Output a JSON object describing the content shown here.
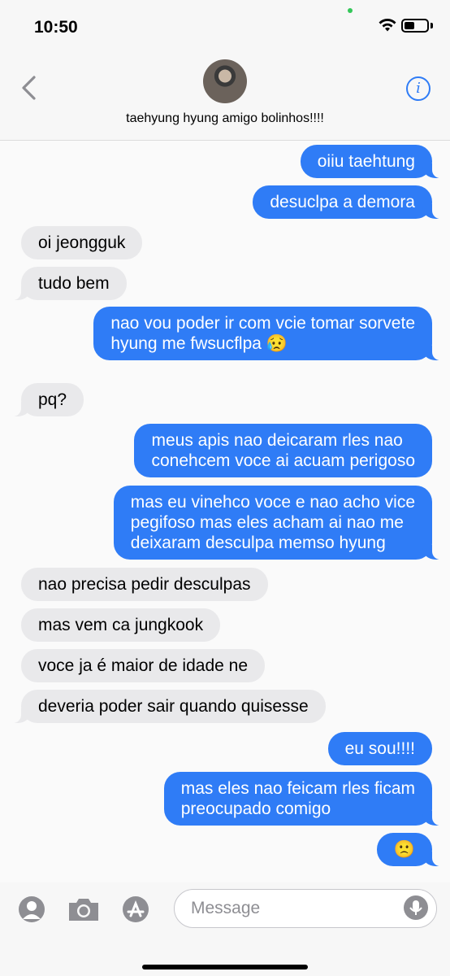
{
  "status_bar": {
    "time": "10:50",
    "battery_level": 0.45
  },
  "header": {
    "contact_name": "taehyung hyung amigo bolinhos!!!!"
  },
  "messages": [
    {
      "dir": "out",
      "text": "oiiu taehtung"
    },
    {
      "dir": "out",
      "text": "desuclpa a demora"
    },
    {
      "dir": "in",
      "text": "oi jeongguk"
    },
    {
      "dir": "in",
      "text": "tudo bem"
    },
    {
      "dir": "out",
      "text": "nao vou poder ir com vcie tomar sorvete\nhyung me fwsucflpa 😥"
    },
    {
      "dir": "in",
      "text": "pq?"
    },
    {
      "dir": "out",
      "text": "meus apis nao deicaram rles nao\nconehcem voce ai acuam perigoso"
    },
    {
      "dir": "out",
      "text": "mas eu vinehco voce e nao acho vice\npegifoso mas eles acham ai nao me\ndeixaram desculpa memso hyung"
    },
    {
      "dir": "in",
      "text": "nao precisa pedir desculpas"
    },
    {
      "dir": "in",
      "text": "mas vem ca jungkook"
    },
    {
      "dir": "in",
      "text": "voce ja é maior de idade ne"
    },
    {
      "dir": "in",
      "text": "deveria poder sair quando quisesse"
    },
    {
      "dir": "out",
      "text": "eu sou!!!!"
    },
    {
      "dir": "out",
      "text": "mas eles nao feicam rles ficam\npreocupado comigo"
    },
    {
      "dir": "out",
      "text": "🙁"
    }
  ],
  "input_bar": {
    "placeholder": "Message"
  },
  "colors": {
    "outgoing": "#2f7cf6",
    "incoming": "#e9e9eb",
    "accent": "#2f7cf6"
  }
}
